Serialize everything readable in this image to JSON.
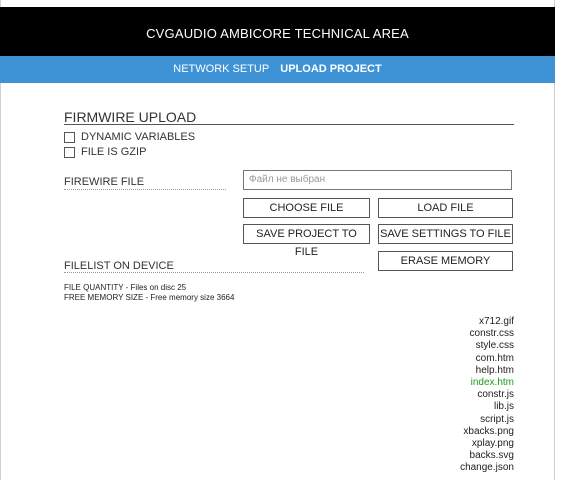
{
  "header": {
    "title": "CVGAUDIO AMBICORE TECHNICAL AREA"
  },
  "nav": {
    "items": [
      {
        "label": "NETWORK SETUP",
        "active": false
      },
      {
        "label": "UPLOAD PROJECT",
        "active": true
      }
    ]
  },
  "firmware": {
    "title": "FIRMWIRE UPLOAD",
    "options": [
      {
        "label": "DYNAMIC VARIABLES",
        "checked": false
      },
      {
        "label": "FILE IS GZIP",
        "checked": false
      }
    ],
    "file_label": "FIREWIRE FILE",
    "file_placeholder": "Файл не выбран",
    "buttons": {
      "choose": "CHOOSE FILE",
      "load": "LOAD FILE",
      "save_project": "SAVE PROJECT TO FILE",
      "save_settings": "SAVE SETTINGS TO FILE",
      "erase": "ERASE MEMORY"
    }
  },
  "filelist": {
    "label": "FILELIST ON DEVICE",
    "quantity": "FILE QUANTITY - Files on disc 25",
    "memory": "FREE MEMORY SIZE - Free memory size 3664",
    "files": [
      {
        "name": "x712.gif",
        "highlight": false
      },
      {
        "name": "constr.css",
        "highlight": false
      },
      {
        "name": "style.css",
        "highlight": false
      },
      {
        "name": "com.htm",
        "highlight": false
      },
      {
        "name": "help.htm",
        "highlight": false
      },
      {
        "name": "index.htm",
        "highlight": true
      },
      {
        "name": "constr.js",
        "highlight": false
      },
      {
        "name": "lib.js",
        "highlight": false
      },
      {
        "name": "script.js",
        "highlight": false
      },
      {
        "name": "xbacks.png",
        "highlight": false
      },
      {
        "name": "xplay.png",
        "highlight": false
      },
      {
        "name": "backs.svg",
        "highlight": false
      },
      {
        "name": "change.json",
        "highlight": false
      }
    ]
  },
  "colors": {
    "nav_bg": "#3d93d6",
    "header_bg": "#000000",
    "highlight_file": "#1f9a1f"
  }
}
